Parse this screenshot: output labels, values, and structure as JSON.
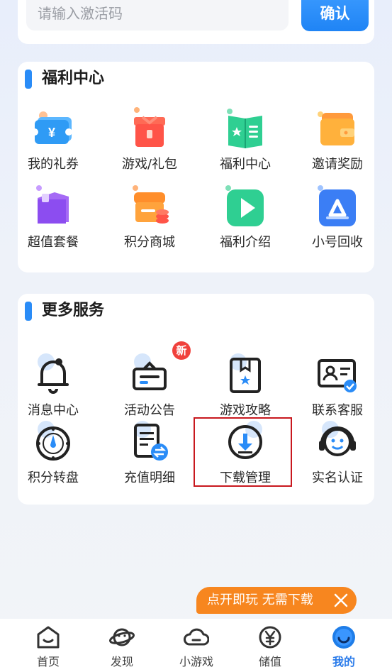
{
  "redeem": {
    "placeholder": "请输入激活码",
    "confirm_label": "确认"
  },
  "welfare": {
    "title": "福利中心",
    "items": [
      {
        "label": "我的礼券",
        "icon": "coupon-icon"
      },
      {
        "label": "游戏/礼包",
        "icon": "gift-box-icon"
      },
      {
        "label": "福利中心",
        "icon": "welfare-book-icon"
      },
      {
        "label": "邀请奖励",
        "icon": "wallet-icon"
      },
      {
        "label": "超值套餐",
        "icon": "bundle-icon"
      },
      {
        "label": "积分商城",
        "icon": "points-shop-icon"
      },
      {
        "label": "福利介绍",
        "icon": "play-icon"
      },
      {
        "label": "小号回收",
        "icon": "recycle-triangle-icon"
      }
    ]
  },
  "services": {
    "title": "更多服务",
    "new_badge": "新",
    "items": [
      {
        "label": "消息中心",
        "icon": "bell-icon"
      },
      {
        "label": "活动公告",
        "icon": "announcement-icon"
      },
      {
        "label": "游戏攻略",
        "icon": "guide-book-icon"
      },
      {
        "label": "联系客服",
        "icon": "contact-card-icon"
      },
      {
        "label": "积分转盘",
        "icon": "wheel-icon"
      },
      {
        "label": "充值明细",
        "icon": "recharge-detail-icon"
      },
      {
        "label": "下载管理",
        "icon": "download-icon"
      },
      {
        "label": "实名认证",
        "icon": "headset-face-icon"
      }
    ]
  },
  "promo": {
    "text": "点开即玩 无需下载"
  },
  "tabs": [
    {
      "label": "首页",
      "icon": "home-icon"
    },
    {
      "label": "发现",
      "icon": "planet-icon"
    },
    {
      "label": "小游戏",
      "icon": "cloud-icon"
    },
    {
      "label": "储值",
      "icon": "yen-coin-icon"
    },
    {
      "label": "我的",
      "icon": "profile-icon",
      "active": true
    }
  ],
  "colors": {
    "accent": "#2a8cf7",
    "promo": "#f7861f",
    "badge": "#f0413c",
    "highlight": "#c8181e"
  }
}
